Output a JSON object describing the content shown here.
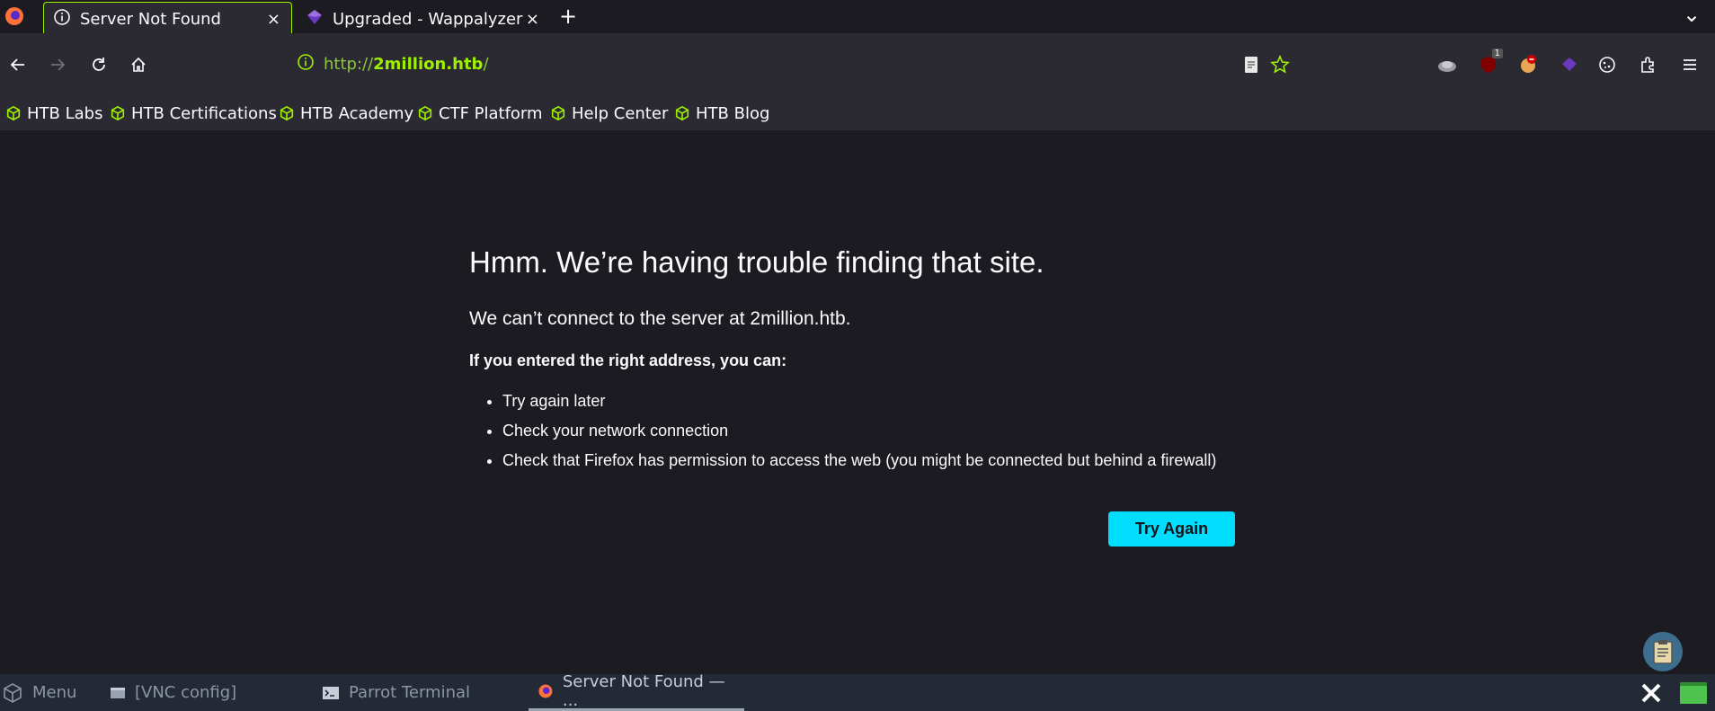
{
  "tabs": [
    {
      "title": "Server Not Found",
      "icon": "info-icon",
      "close": "×"
    },
    {
      "title": "Upgraded - Wappalyzer",
      "icon": "wappalyzer-icon",
      "close": "×"
    }
  ],
  "new_tab": "+",
  "tab_overflow": "⌄",
  "url": {
    "prefix": "http://",
    "host": "2million.htb",
    "suffix": "/"
  },
  "bookmarks": [
    "HTB Labs",
    "HTB Certifications",
    "HTB Academy",
    "CTF Platform",
    "Help Center",
    "HTB Blog"
  ],
  "extensions": {
    "ublock_badge": "1"
  },
  "error": {
    "title": "Hmm. We’re having trouble finding that site.",
    "description": "We can’t connect to the server at 2million.htb.",
    "subtitle": "If you entered the right address, you can:",
    "items": [
      "Try again later",
      "Check your network connection",
      "Check that Firefox has permission to access the web (you might be connected but behind a firewall)"
    ],
    "button": "Try Again"
  },
  "taskbar": {
    "menu": "Menu",
    "tasks": [
      "[VNC config]",
      "Parrot Terminal",
      "Server Not Found — ..."
    ]
  },
  "colors": {
    "accent": "#9fef00",
    "button": "#00ddff",
    "background": "#1c1b22",
    "toolbar": "#2b2a33"
  }
}
